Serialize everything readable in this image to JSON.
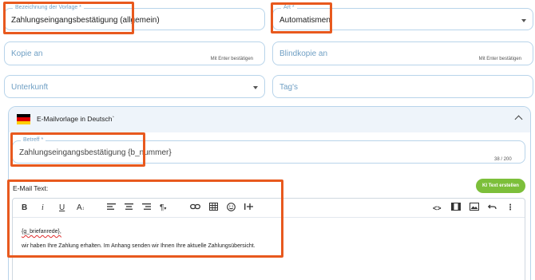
{
  "fields": {
    "vorlage": {
      "label": "Bezeichnung der Vorlage *",
      "value": "Zahlungseingangsbestätigung (allgemein)"
    },
    "art": {
      "label": "Art *",
      "value": "Automatismen"
    },
    "kopie": {
      "placeholder": "Kopie an",
      "hint": "Mit Enter bestätigen"
    },
    "blindkopie": {
      "placeholder": "Blindkopie an",
      "hint": "Mit Enter bestätigen"
    },
    "unterkunft": {
      "placeholder": "Unterkunft"
    },
    "tags": {
      "placeholder": "Tag's"
    }
  },
  "panel": {
    "title": "E-Mailvorlage in Deutsch`",
    "flag_colors": [
      "#000000",
      "#dd0000",
      "#ffce00"
    ],
    "betreff": {
      "label": "Betreff *",
      "value": "Zahlungseingangsbestätigung {b_nummer}",
      "counter": "38 / 200"
    },
    "email_text_label": "E-Mail Text:",
    "ki_button": "KI Text erstellen",
    "editor": {
      "line1": "{g_briefanrede},",
      "line2": "wir haben Ihre Zahlung erhalten. Im Anhang senden wir Ihnen Ihre aktuelle Zahlungsübersicht."
    }
  },
  "toolbar_icons": [
    "bold-icon",
    "italic-icon",
    "underline-icon",
    "font-size-icon",
    "align-left-icon",
    "align-center-icon",
    "align-right-icon",
    "paragraph-icon",
    "link-icon",
    "table-icon",
    "emoji-icon",
    "insert-icon",
    "code-view-icon",
    "preview-icon",
    "image-icon",
    "undo-icon",
    "more-icon"
  ],
  "accent_color": "#e8591e",
  "ki_color": "#7cbf3a"
}
